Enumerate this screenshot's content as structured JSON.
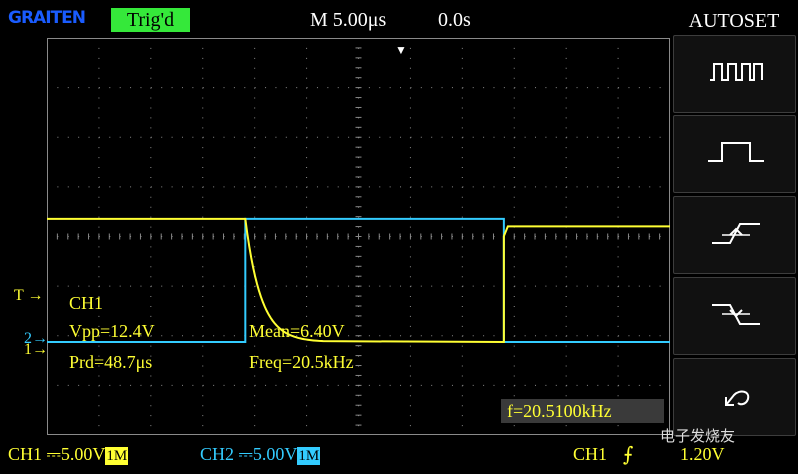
{
  "brand": "GRAITEN",
  "status": {
    "trigger_state": "Trig'd",
    "timebase": "M 5.00μs",
    "trigger_position": "0.0s"
  },
  "colors": {
    "ch1": "#ffff33",
    "ch2": "#33ccff",
    "trigger_badge": "#35e83a",
    "grid": "#8a8a8a",
    "panel_bg": "#111111",
    "freq_box": "#3a3a3a"
  },
  "side_menu": {
    "title": "AUTOSET",
    "buttons": [
      {
        "icon": "multi-cycle-waveform-icon"
      },
      {
        "icon": "single-cycle-waveform-icon"
      },
      {
        "icon": "rising-edge-icon"
      },
      {
        "icon": "falling-edge-icon"
      },
      {
        "icon": "undo-icon"
      }
    ]
  },
  "markers": {
    "trigger": "T",
    "ch2": "2",
    "ch1": "1"
  },
  "measurements": {
    "channel": "CH1",
    "vpp": "Vpp=12.4V",
    "mean": "Mean=6.40V",
    "period": "Prd=48.7μs",
    "freq": "Freq=20.5kHz"
  },
  "frequency_counter": "f=20.5100kHz",
  "bottom": {
    "ch1_label": "CH1",
    "ch1_coupling": "⎓",
    "ch1_scale": "5.00V",
    "ch1_impedance": "1M",
    "ch2_label": "CH2",
    "ch2_coupling": "⎓",
    "ch2_scale": "5.00V",
    "ch2_impedance": "1M",
    "trigger_source": "CH1",
    "trigger_edge": "⨍",
    "trigger_level": "1.20V"
  },
  "watermark": "电子发烧友",
  "waveforms": {
    "ch1_high_v": 12.4,
    "ch1_low_v": 0.0,
    "ch2_high_v": 12.4,
    "ch2_low_v": 0.0,
    "volts_per_div": 5.0,
    "time_per_div_us": 5.0,
    "ch1_fall_times_us": [
      -10.9,
      37.8
    ],
    "ch1_rise_times_us": [
      14.0
    ],
    "ch2_rise_times_us": [
      -10.9,
      37.8
    ],
    "ch2_fall_times_us": [
      14.0
    ],
    "ch1_decay_tau_us": 1.5
  }
}
